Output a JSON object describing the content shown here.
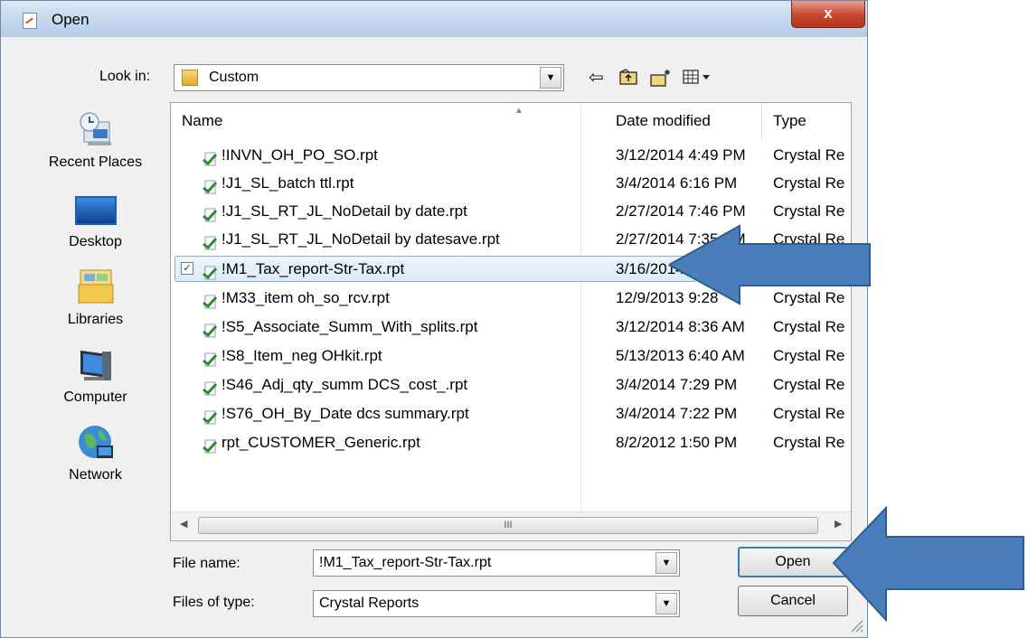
{
  "window": {
    "title": "Open",
    "close_label": "x"
  },
  "lookin": {
    "label": "Look in:",
    "value": "Custom"
  },
  "toolbar": {
    "icons": [
      "back-icon",
      "up-folder-icon",
      "new-folder-icon",
      "view-menu-icon"
    ]
  },
  "places": [
    {
      "label": "Recent Places",
      "icon": "recent-places-icon"
    },
    {
      "label": "Desktop",
      "icon": "desktop-icon"
    },
    {
      "label": "Libraries",
      "icon": "libraries-icon"
    },
    {
      "label": "Computer",
      "icon": "computer-icon"
    },
    {
      "label": "Network",
      "icon": "network-icon"
    }
  ],
  "columns": {
    "name": "Name",
    "date": "Date modified",
    "type": "Type"
  },
  "files": [
    {
      "name": "!INVN_OH_PO_SO.rpt",
      "date": "3/12/2014 4:49 PM",
      "type": "Crystal Re"
    },
    {
      "name": "!J1_SL_batch ttl.rpt",
      "date": "3/4/2014 6:16 PM",
      "type": "Crystal Re"
    },
    {
      "name": "!J1_SL_RT_JL_NoDetail by date.rpt",
      "date": "2/27/2014 7:46 PM",
      "type": "Crystal Re"
    },
    {
      "name": "!J1_SL_RT_JL_NoDetail by datesave.rpt",
      "date": "2/27/2014 7:35 PM",
      "type": "Crystal Re"
    },
    {
      "name": "!M1_Tax_report-Str-Tax.rpt",
      "date": "3/16/2014 1",
      "type": "Crystal Re",
      "selected": true
    },
    {
      "name": "!M33_item oh_so_rcv.rpt",
      "date": "12/9/2013 9:28",
      "type": "Crystal Re"
    },
    {
      "name": "!S5_Associate_Summ_With_splits.rpt",
      "date": "3/12/2014 8:36 AM",
      "type": "Crystal Re"
    },
    {
      "name": "!S8_Item_neg OHkit.rpt",
      "date": "5/13/2013 6:40 AM",
      "type": "Crystal Re"
    },
    {
      "name": "!S46_Adj_qty_summ DCS_cost_.rpt",
      "date": "3/4/2014 7:29 PM",
      "type": "Crystal Re"
    },
    {
      "name": "!S76_OH_By_Date dcs summary.rpt",
      "date": "3/4/2014 7:22 PM",
      "type": "Crystal Re"
    },
    {
      "name": "rpt_CUSTOMER_Generic.rpt",
      "date": "8/2/2012 1:50 PM",
      "type": "Crystal Re"
    }
  ],
  "scrollbar": {
    "grip": "III"
  },
  "filename": {
    "label": "File name:",
    "value": "!M1_Tax_report-Str-Tax.rpt"
  },
  "filetype": {
    "label": "Files of type:",
    "value": "Crystal Reports"
  },
  "buttons": {
    "open": "Open",
    "cancel": "Cancel"
  },
  "colors": {
    "callout_arrow": "#4a7ebb",
    "selection_border": "#84acdd",
    "title_bar": "#c3d6ec"
  }
}
